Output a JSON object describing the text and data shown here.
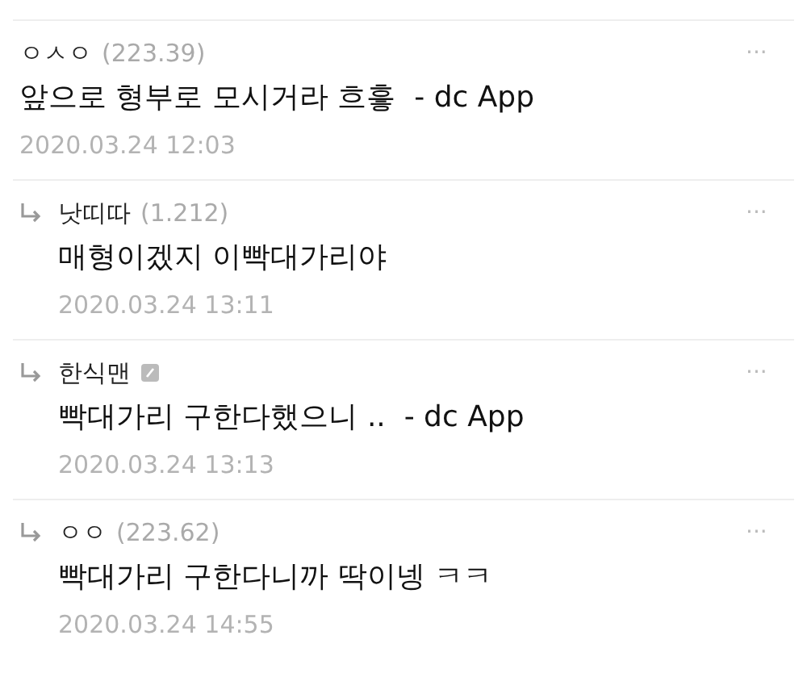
{
  "comments": [
    {
      "kind": "comment",
      "name": "ㅇㅅㅇ",
      "ip": "(223.39)",
      "member": false,
      "text": "앞으로 형부로 모시거라 흐흫  - dc App",
      "date": "2020.03.24 12:03",
      "more": "···"
    },
    {
      "kind": "reply",
      "name": "낫띠따",
      "ip": "(1.212)",
      "member": false,
      "text": "매형이겠지 이빡대가리야",
      "date": "2020.03.24 13:11",
      "more": "···"
    },
    {
      "kind": "reply",
      "name": "한식맨",
      "member": true,
      "text": "빡대가리 구한다했으니 ..  - dc App",
      "date": "2020.03.24 13:13",
      "more": "···"
    },
    {
      "kind": "reply",
      "name": "ㅇㅇ",
      "ip": "(223.62)",
      "member": false,
      "text": "빡대가리 구한다니까 딱이넹 ㅋㅋ",
      "date": "2020.03.24 14:55",
      "more": "···"
    }
  ]
}
